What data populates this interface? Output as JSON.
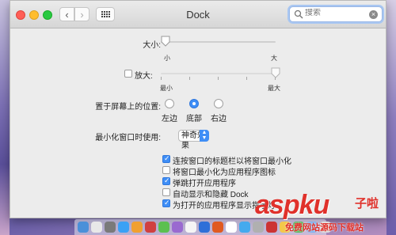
{
  "window": {
    "title": "Dock"
  },
  "search": {
    "placeholder": "搜索"
  },
  "size": {
    "label": "大小:",
    "min_label": "小",
    "max_label": "大",
    "value_fraction": 0.0
  },
  "magnification": {
    "label": "放大:",
    "checked": false,
    "min_label": "最小",
    "max_label": "最大",
    "value_fraction": 1.0
  },
  "position": {
    "label": "置于屏幕上的位置:",
    "options": [
      {
        "label": "左边",
        "selected": false
      },
      {
        "label": "底部",
        "selected": true
      },
      {
        "label": "右边",
        "selected": false
      }
    ]
  },
  "minimize": {
    "label": "最小化窗口时使用:",
    "selected": "神奇效果"
  },
  "options": [
    {
      "label": "连按窗口的标题栏以将窗口最小化",
      "checked": true
    },
    {
      "label": "将窗口最小化为应用程序图标",
      "checked": false
    },
    {
      "label": "弹跳打开应用程序",
      "checked": true
    },
    {
      "label": "自动显示和隐藏 Dock",
      "checked": false
    },
    {
      "label": "为打开的应用程序显示指示灯",
      "checked": true
    }
  ],
  "dock_icon_colors": [
    "#4a90d9",
    "#e8e8e8",
    "#7a7a7a",
    "#3ba1f5",
    "#f0a030",
    "#d04040",
    "#5cc050",
    "#9a6ad0",
    "#f5f5f5",
    "#2e6fd8",
    "#e05a20",
    "#ffffff",
    "#44aaee",
    "#b0b0b0",
    "#cc3333",
    "#f3c84a",
    "#58b85c",
    "#7fb2f0",
    "#d9d9d9"
  ],
  "watermark": {
    "main": "aspku",
    "sub": "子啦",
    "line": "免费网站源码下载站"
  }
}
